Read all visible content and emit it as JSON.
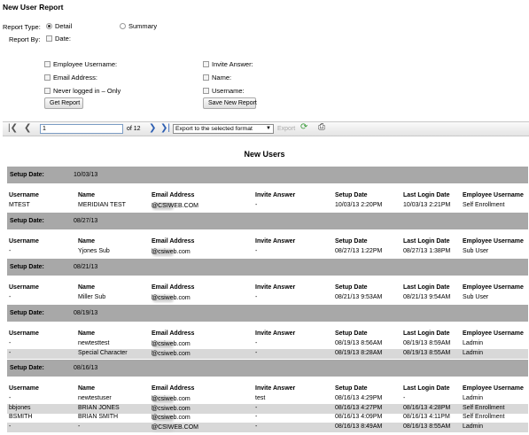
{
  "page": {
    "title": "New User Report"
  },
  "filters": {
    "report_type_label": "Report Type:",
    "detail_label": "Detail",
    "summary_label": "Summary",
    "report_by_label": "Report By:",
    "date_label": "Date:",
    "employee_username_label": "Employee Username:",
    "email_address_label": "Email Address:",
    "never_logged_in_label": "Never logged in – Only",
    "invite_answer_label": "Invite Answer:",
    "name_label": "Name:",
    "username_label": "Username:",
    "get_report_label": "Get Report",
    "save_new_report_label": "Save New Report"
  },
  "toolbar": {
    "page_value": "1",
    "page_of": "of 12",
    "export_select": "Export to the selected format",
    "export_label": "Export"
  },
  "report": {
    "title": "New Users",
    "setup_date_label": "Setup Date:",
    "columns": [
      "Username",
      "Name",
      "Email Address",
      "Invite Answer",
      "Setup Date",
      "Last Login Date",
      "Employee Username"
    ],
    "groups": [
      {
        "setup_date": "10/03/13",
        "rows": [
          {
            "username": "MTEST",
            "name": "MERIDIAN TEST",
            "email_pre": "LAURA",
            "email_post": "@CSIWEB.COM",
            "invite": "-",
            "setup": "10/03/13 2:20PM",
            "last_login": "10/03/13 2:21PM",
            "employee": "Self Enrollment"
          }
        ]
      },
      {
        "setup_date": "08/27/13",
        "rows": [
          {
            "username": "-",
            "name": "Yjones Sub",
            "email_pre": "laura",
            "email_post": "@csiweb.com",
            "invite": "-",
            "setup": "08/27/13 1:22PM",
            "last_login": "08/27/13 1:38PM",
            "employee": "Sub User"
          }
        ]
      },
      {
        "setup_date": "08/21/13",
        "rows": [
          {
            "username": "-",
            "name": "Miller Sub",
            "email_pre": "laura",
            "email_post": "@csiweb.com",
            "invite": "-",
            "setup": "08/21/13 9:53AM",
            "last_login": "08/21/13 9:54AM",
            "employee": "Sub User"
          }
        ]
      },
      {
        "setup_date": "08/19/13",
        "rows": [
          {
            "username": "-",
            "name": "newtesttest",
            "email_pre": "laura",
            "email_post": "@csiweb.com",
            "invite": "-",
            "setup": "08/19/13 8:56AM",
            "last_login": "08/19/13 8:59AM",
            "employee": "Ladmin"
          },
          {
            "username": "-",
            "name": "Special Character",
            "email_pre": "laura",
            "email_post": "@csiweb.com",
            "invite": "-",
            "setup": "08/19/13 8:28AM",
            "last_login": "08/19/13 8:55AM",
            "employee": "Ladmin"
          }
        ]
      },
      {
        "setup_date": "08/16/13",
        "rows": [
          {
            "username": "-",
            "name": "newtestuser",
            "email_pre": "laura",
            "email_post": "@csiweb.com",
            "invite": "test",
            "setup": "08/16/13 4:29PM",
            "last_login": "-",
            "employee": "Ladmin"
          },
          {
            "username": "bbjones",
            "name": "BRIAN JONES",
            "email_pre": "laura",
            "email_post": "@csiweb.com",
            "invite": "-",
            "setup": "08/16/13 4:27PM",
            "last_login": "08/16/13 4:28PM",
            "employee": "Self Enrollment"
          },
          {
            "username": "BSMITH",
            "name": "BRIAN SMITH",
            "email_pre": "laura",
            "email_post": "@csiweb.com",
            "invite": "-",
            "setup": "08/16/13 4:09PM",
            "last_login": "08/16/13 4:11PM",
            "employee": "Self Enrollment"
          },
          {
            "username": "-",
            "name": "-",
            "email_pre": "LAUR",
            "email_post": "@CSIWEB.COM",
            "invite": "-",
            "setup": "08/16/13 8:49AM",
            "last_login": "08/16/13 8:55AM",
            "employee": "Ladmin"
          }
        ]
      }
    ]
  }
}
